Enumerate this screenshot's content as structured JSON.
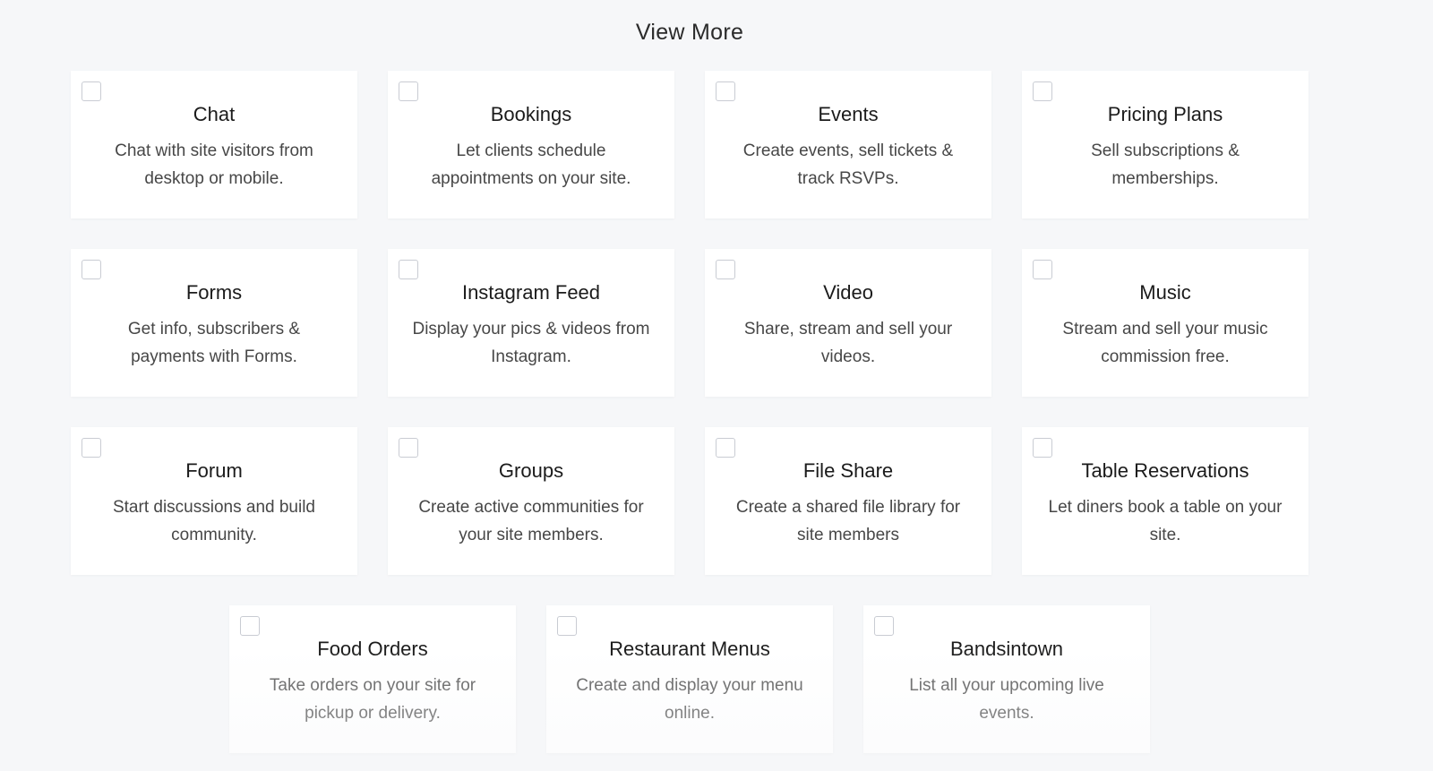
{
  "heading": "View More",
  "rows": [
    [
      {
        "title": "Chat",
        "desc": "Chat with site visitors from desktop or mobile."
      },
      {
        "title": "Bookings",
        "desc": "Let clients schedule appointments on your site."
      },
      {
        "title": "Events",
        "desc": "Create events, sell tickets & track RSVPs."
      },
      {
        "title": "Pricing Plans",
        "desc": "Sell subscriptions & memberships."
      }
    ],
    [
      {
        "title": "Forms",
        "desc": "Get info, subscribers & payments with Forms."
      },
      {
        "title": "Instagram Feed",
        "desc": "Display your pics & videos from Instagram."
      },
      {
        "title": "Video",
        "desc": "Share, stream and sell your videos."
      },
      {
        "title": "Music",
        "desc": "Stream and sell your music commission free."
      }
    ],
    [
      {
        "title": "Forum",
        "desc": "Start discussions and build community."
      },
      {
        "title": "Groups",
        "desc": "Create active communities for your site members."
      },
      {
        "title": "File Share",
        "desc": "Create a shared file library for site members"
      },
      {
        "title": "Table Reservations",
        "desc": "Let diners book a table on your site."
      }
    ],
    [
      {
        "title": "Food Orders",
        "desc": "Take orders on your site for pickup or delivery."
      },
      {
        "title": "Restaurant Menus",
        "desc": "Create and display your menu online."
      },
      {
        "title": "Bandsintown",
        "desc": "List all your upcoming live events."
      }
    ]
  ]
}
